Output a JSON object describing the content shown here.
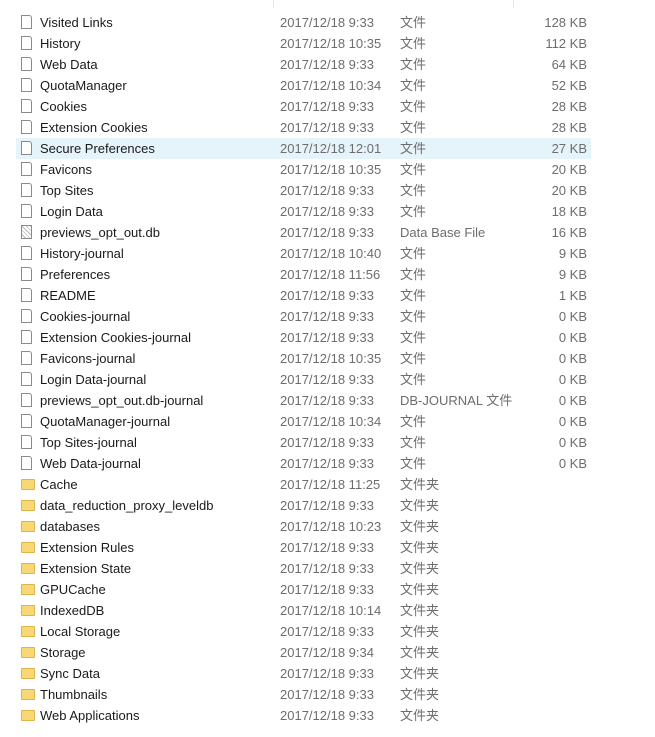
{
  "files": [
    [
      "Visited Links",
      "2017/12/18 9:33",
      "文件",
      "128 KB",
      "file"
    ],
    [
      "History",
      "2017/12/18 10:35",
      "文件",
      "112 KB",
      "file"
    ],
    [
      "Web Data",
      "2017/12/18 9:33",
      "文件",
      "64 KB",
      "file"
    ],
    [
      "QuotaManager",
      "2017/12/18 10:34",
      "文件",
      "52 KB",
      "file"
    ],
    [
      "Cookies",
      "2017/12/18 9:33",
      "文件",
      "28 KB",
      "file"
    ],
    [
      "Extension Cookies",
      "2017/12/18 9:33",
      "文件",
      "28 KB",
      "file"
    ],
    [
      "Secure Preferences",
      "2017/12/18 12:01",
      "文件",
      "27 KB",
      "file"
    ],
    [
      "Favicons",
      "2017/12/18 10:35",
      "文件",
      "20 KB",
      "file"
    ],
    [
      "Top Sites",
      "2017/12/18 9:33",
      "文件",
      "20 KB",
      "file"
    ],
    [
      "Login Data",
      "2017/12/18 9:33",
      "文件",
      "18 KB",
      "file"
    ],
    [
      "previews_opt_out.db",
      "2017/12/18 9:33",
      "Data Base File",
      "16 KB",
      "db"
    ],
    [
      "History-journal",
      "2017/12/18 10:40",
      "文件",
      "9 KB",
      "file"
    ],
    [
      "Preferences",
      "2017/12/18 11:56",
      "文件",
      "9 KB",
      "file"
    ],
    [
      "README",
      "2017/12/18 9:33",
      "文件",
      "1 KB",
      "file"
    ],
    [
      "Cookies-journal",
      "2017/12/18 9:33",
      "文件",
      "0 KB",
      "file"
    ],
    [
      "Extension Cookies-journal",
      "2017/12/18 9:33",
      "文件",
      "0 KB",
      "file"
    ],
    [
      "Favicons-journal",
      "2017/12/18 10:35",
      "文件",
      "0 KB",
      "file"
    ],
    [
      "Login Data-journal",
      "2017/12/18 9:33",
      "文件",
      "0 KB",
      "file"
    ],
    [
      "previews_opt_out.db-journal",
      "2017/12/18 9:33",
      "DB-JOURNAL 文件",
      "0 KB",
      "file"
    ],
    [
      "QuotaManager-journal",
      "2017/12/18 10:34",
      "文件",
      "0 KB",
      "file"
    ],
    [
      "Top Sites-journal",
      "2017/12/18 9:33",
      "文件",
      "0 KB",
      "file"
    ],
    [
      "Web Data-journal",
      "2017/12/18 9:33",
      "文件",
      "0 KB",
      "file"
    ],
    [
      "Cache",
      "2017/12/18 11:25",
      "文件夹",
      "",
      "folder"
    ],
    [
      "data_reduction_proxy_leveldb",
      "2017/12/18 9:33",
      "文件夹",
      "",
      "folder"
    ],
    [
      "databases",
      "2017/12/18 10:23",
      "文件夹",
      "",
      "folder"
    ],
    [
      "Extension Rules",
      "2017/12/18 9:33",
      "文件夹",
      "",
      "folder"
    ],
    [
      "Extension State",
      "2017/12/18 9:33",
      "文件夹",
      "",
      "folder"
    ],
    [
      "GPUCache",
      "2017/12/18 9:33",
      "文件夹",
      "",
      "folder"
    ],
    [
      "IndexedDB",
      "2017/12/18 10:14",
      "文件夹",
      "",
      "folder"
    ],
    [
      "Local Storage",
      "2017/12/18 9:33",
      "文件夹",
      "",
      "folder"
    ],
    [
      "Storage",
      "2017/12/18 9:34",
      "文件夹",
      "",
      "folder"
    ],
    [
      "Sync Data",
      "2017/12/18 9:33",
      "文件夹",
      "",
      "folder"
    ],
    [
      "Thumbnails",
      "2017/12/18 9:33",
      "文件夹",
      "",
      "folder"
    ],
    [
      "Web Applications",
      "2017/12/18 9:33",
      "文件夹",
      "",
      "folder"
    ]
  ],
  "selected_index": 6
}
